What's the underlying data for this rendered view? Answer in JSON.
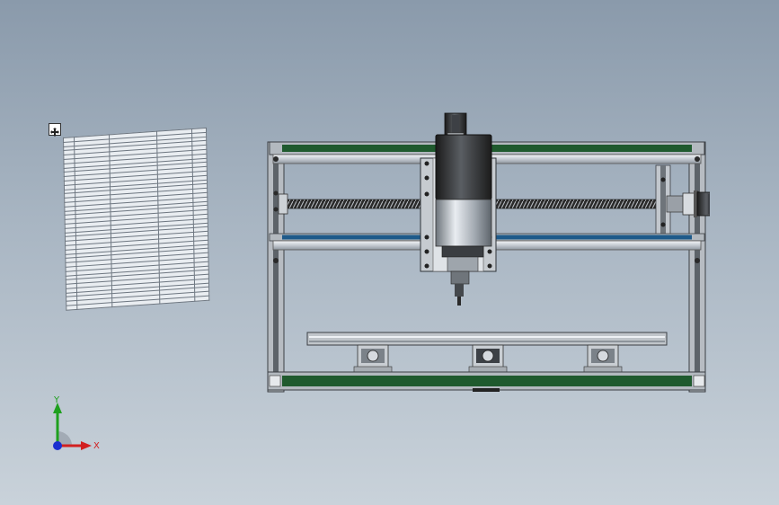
{
  "colors": {
    "background_top": "#8a9aab",
    "background_bottom": "#c9d2da",
    "frame_green": "#1f5a2e",
    "aluminum": "#b9bec4",
    "rail_steel": "#dfe3e8",
    "motor_black": "#2a2a2a",
    "axis_x": "#d22020",
    "axis_y": "#1ea01e",
    "axis_z": "#1a2fd0"
  },
  "axes": {
    "x_label": "X",
    "y_label": "Y"
  },
  "icons": {
    "move_handle": "four-arrow-move-icon"
  },
  "bom": {
    "rows": 40,
    "cols": 5
  }
}
